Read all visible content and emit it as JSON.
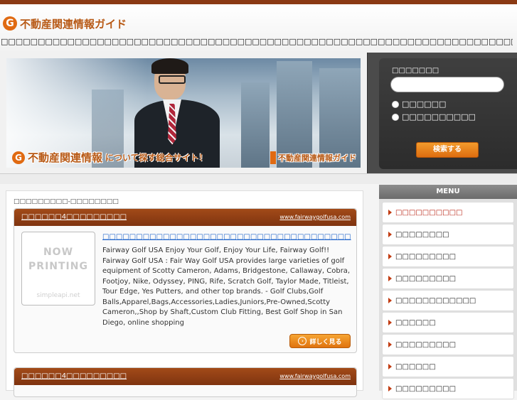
{
  "header": {
    "logo_mark": "G",
    "logo_text": "不動産関連情報ガイド",
    "tagline": "□□□□□□□□□□□□□□□□□□□□□□□□□□□□□□□□□□□□□□□□□□□□□□□□□□□□□□□□□□□□□□□□□□□□□□□□□□□□□□□□□□□□□□□□□□"
  },
  "hero": {
    "caption_mark": "G",
    "caption_main": "不動産関連情報",
    "caption_sub": "について探す総合サイト！",
    "caption_right": "不動産関連情報ガイド"
  },
  "search": {
    "label": "□□□□□□□",
    "input_value": "",
    "options": [
      "□□□□□□",
      "□□□□□□□□□□"
    ],
    "button": "検索する"
  },
  "main": {
    "breadcrumb": "□□□□□□□□□-□□□□□□□□",
    "cards": [
      {
        "title": "□□□□□□4□□□□□□□□□",
        "domain": "www.fairwaygolfusa.com",
        "thumb_line1": "NOW",
        "thumb_line2": "PRINTING",
        "thumb_footer": "simpleapi.net",
        "link": "□□□□□□□□□□□□□□□□□□□□□□□□□□□□□□□□□□□□□",
        "description": "Fairway Golf USA Enjoy Your Golf, Enjoy Your Life, Fairway Golf!! Fairway Golf USA : Fair Way Golf USA provides large varieties of golf equipment of Scotty Cameron, Adams, Bridgestone, Callaway, Cobra, Footjoy, Nike, Odyssey, PING, Rife, Scratch Golf, Taylor Made, Titleist, Tour Edge, Yes Putters, and other top brands. - Golf Clubs,Golf Balls,Apparel,Bags,Accessories,Ladies,Juniors,Pre-Owned,Scotty Cameron,,Shop by Shaft,Custom Club Fitting, Best Golf Shop in San Diego, online shopping",
        "button": "詳しく見る"
      },
      {
        "title": "□□□□□□4□□□□□□□□□",
        "domain": "www.fairwaygolfusa.com"
      }
    ]
  },
  "sidebar": {
    "menu_title": "MENU",
    "items": [
      "□□□□□□□□□□",
      "□□□□□□□□",
      "□□□□□□□□□",
      "□□□□□□□□□",
      "□□□□□□□□□□□□",
      "□□□□□□",
      "□□□□□□□□□",
      "□□□□□□",
      "□□□□□□□□□"
    ]
  },
  "colors": {
    "accent_orange": "#e06a12",
    "header_brown": "#8b3a14",
    "card_head": "#a24a18",
    "link_blue": "#2266cc"
  }
}
